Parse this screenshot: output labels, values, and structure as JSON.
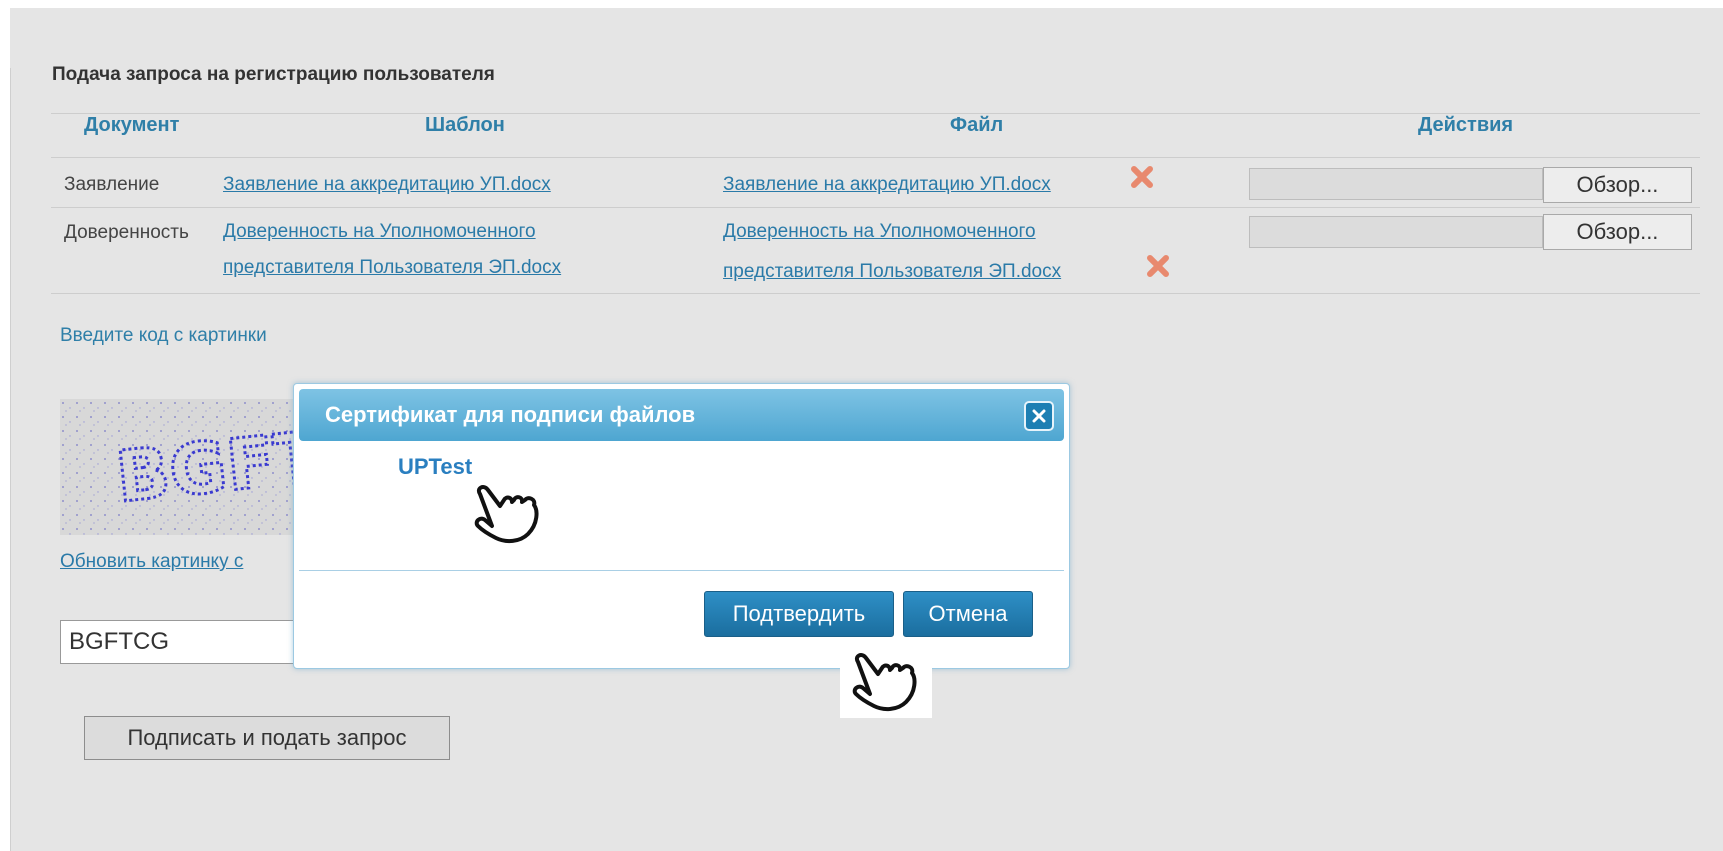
{
  "form": {
    "title": "Подача запроса на регистрацию пользователя",
    "columns": [
      "Документ",
      "Шаблон",
      "Файл",
      "Действия"
    ],
    "rows": [
      {
        "document": "Заявление",
        "template_link": "Заявление на аккредитацию УП.docx",
        "file_link": "Заявление на аккредитацию УП.docx",
        "browse_label": "Обзор..."
      },
      {
        "document": "Доверенность",
        "template_link_line1": "Доверенность на Уполномоченного",
        "template_link_line2": "представителя Пользователя ЭП.docx",
        "file_link_line1": "Доверенность на Уполномоченного",
        "file_link_line2": "представителя Пользователя ЭП.docx",
        "browse_label": "Обзор..."
      }
    ],
    "captcha_label": "Введите код с картинки",
    "captcha_code": "BGFTCG",
    "refresh_link": "Обновить картинку с",
    "captcha_input_value": "BGFTCG",
    "submit_label": "Подписать и подать запрос"
  },
  "dialog": {
    "title": "Сертификат для подписи файлов",
    "certificate": "UPTest",
    "confirm_label": "Подтвердить",
    "cancel_label": "Отмена"
  },
  "colors": {
    "background": "#e5e5e5",
    "link": "#2a7aa8",
    "header": "#2f7fa8",
    "dialog_title": "#4ea6d1",
    "button": "#1b6e9f",
    "remove_icon": "#e8896e"
  },
  "icons": [
    "remove-file-icon",
    "dialog-close-icon",
    "pointer-hand-icon"
  ]
}
